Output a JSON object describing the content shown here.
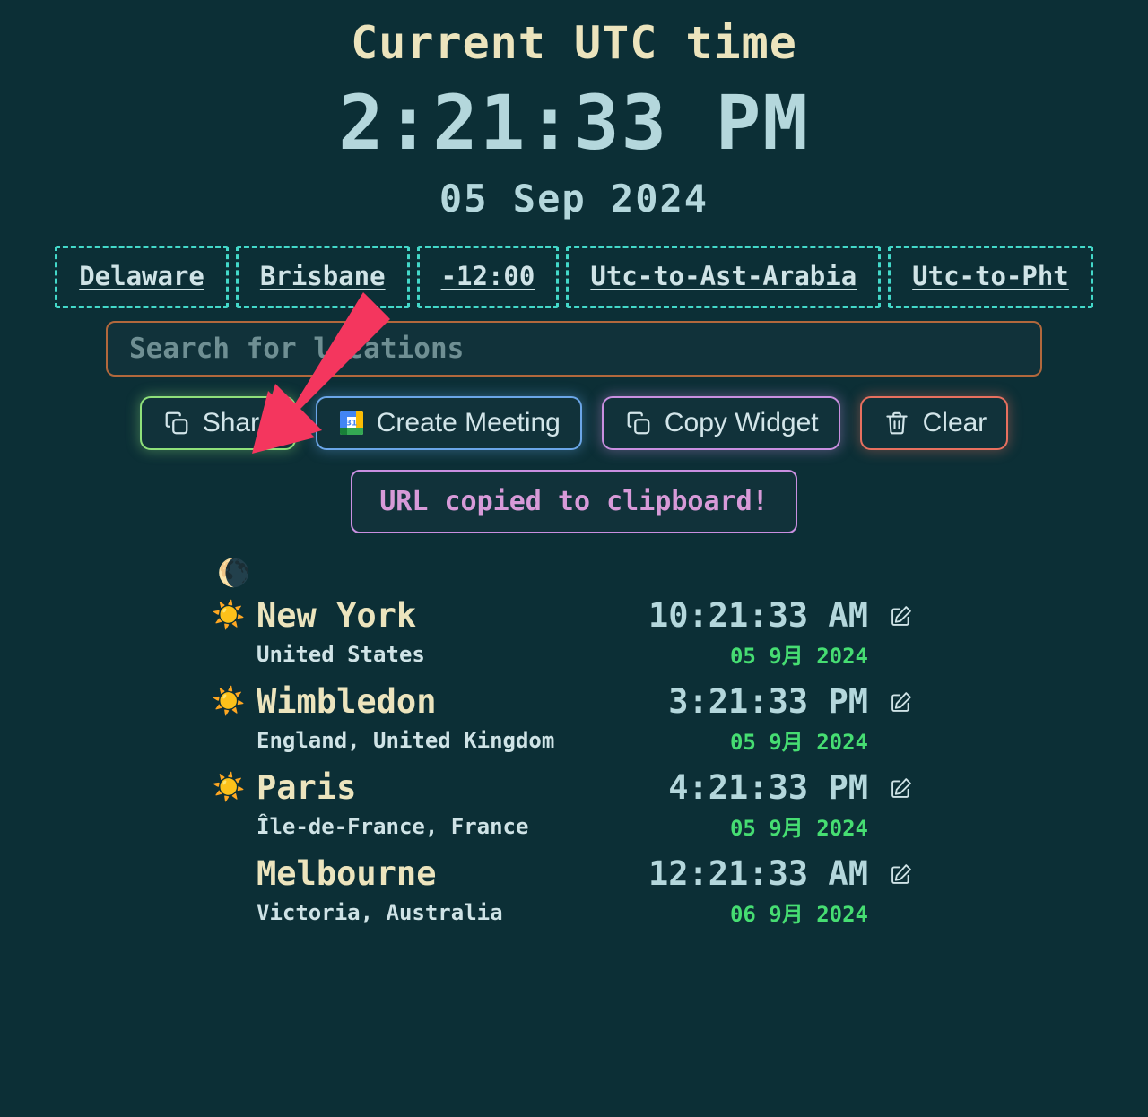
{
  "header": {
    "title": "Current UTC time",
    "time": "2:21:33 PM",
    "date": "05 Sep 2024"
  },
  "chips": [
    {
      "label": "Delaware"
    },
    {
      "label": "Brisbane"
    },
    {
      "label": "-12:00"
    },
    {
      "label": "Utc-to-Ast-Arabia"
    },
    {
      "label": "Utc-to-Pht"
    }
  ],
  "search": {
    "placeholder": "Search for locations",
    "value": ""
  },
  "actions": {
    "share": {
      "label": "Share",
      "icon": "copy-icon"
    },
    "create_meeting": {
      "label": "Create Meeting",
      "icon": "google-calendar-icon"
    },
    "copy_widget": {
      "label": "Copy Widget",
      "icon": "copy-icon"
    },
    "clear": {
      "label": "Clear",
      "icon": "trash-icon"
    }
  },
  "toast": {
    "message": "URL copied to clipboard!"
  },
  "standalone_moon": "🌘",
  "cities": [
    {
      "icon": "☀️",
      "name": "New York",
      "region": "United States",
      "time": "10:21:33 AM",
      "date": "05 9月 2024",
      "edit_icon": "edit-icon"
    },
    {
      "icon": "☀️",
      "name": "Wimbledon",
      "region": "England, United Kingdom",
      "time": "3:21:33 PM",
      "date": "05 9月 2024",
      "edit_icon": "edit-icon"
    },
    {
      "icon": "☀️",
      "name": "Paris",
      "region": "Île-de-France, France",
      "time": "4:21:33 PM",
      "date": "05 9月 2024",
      "edit_icon": "edit-icon"
    },
    {
      "icon": "",
      "name": "Melbourne",
      "region": "Victoria, Australia",
      "time": "12:21:33 AM",
      "date": "06 9月 2024",
      "edit_icon": "edit-icon"
    }
  ],
  "colors": {
    "background": "#0c2f36",
    "title": "#ece4bd",
    "clock": "#b4d7dc",
    "chip_border": "#43d8c9",
    "search_border": "#b2683c",
    "share_border": "#8fe07a",
    "meeting_border": "#6ba6e8",
    "copy_border": "#c98fe0",
    "clear_border": "#e8705f",
    "toast_text": "#d79ad8",
    "date_green": "#46dd72",
    "arrow": "#f4365e"
  }
}
